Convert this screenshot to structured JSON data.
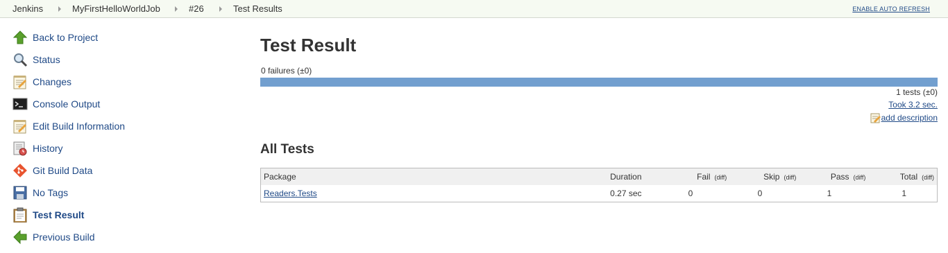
{
  "breadcrumbs": [
    "Jenkins",
    "MyFirstHelloWorldJob",
    "#26",
    "Test Results"
  ],
  "auto_refresh_label": "ENABLE AUTO REFRESH",
  "sidebar": {
    "items": [
      {
        "label": "Back to Project",
        "icon": "up-arrow-icon"
      },
      {
        "label": "Status",
        "icon": "magnifier-icon"
      },
      {
        "label": "Changes",
        "icon": "notepad-icon"
      },
      {
        "label": "Console Output",
        "icon": "terminal-icon"
      },
      {
        "label": "Edit Build Information",
        "icon": "notepad-edit-icon"
      },
      {
        "label": "History",
        "icon": "history-icon"
      },
      {
        "label": "Git Build Data",
        "icon": "git-icon"
      },
      {
        "label": "No Tags",
        "icon": "save-icon"
      },
      {
        "label": "Test Result",
        "icon": "clipboard-icon",
        "active": true
      },
      {
        "label": "Previous Build",
        "icon": "left-arrow-icon"
      }
    ]
  },
  "main": {
    "title": "Test Result",
    "failures": "0 failures (±0)",
    "pass_fraction": 1.0,
    "tests_count": "1 tests (±0)",
    "took": "Took 3.2 sec.",
    "add_description": "add description",
    "all_tests_heading": "All Tests",
    "table": {
      "headers": {
        "package": "Package",
        "duration": "Duration",
        "fail": "Fail",
        "skip": "Skip",
        "pass": "Pass",
        "total": "Total",
        "diff": "(diff)"
      },
      "rows": [
        {
          "package": "Readers.Tests",
          "duration": "0.27 sec",
          "fail": "0",
          "skip": "0",
          "pass": "1",
          "total": "1"
        }
      ]
    }
  },
  "colors": {
    "link": "#204a87",
    "progress_pass": "#729fcf",
    "breadcrumb_bg": "#f6faf2"
  }
}
